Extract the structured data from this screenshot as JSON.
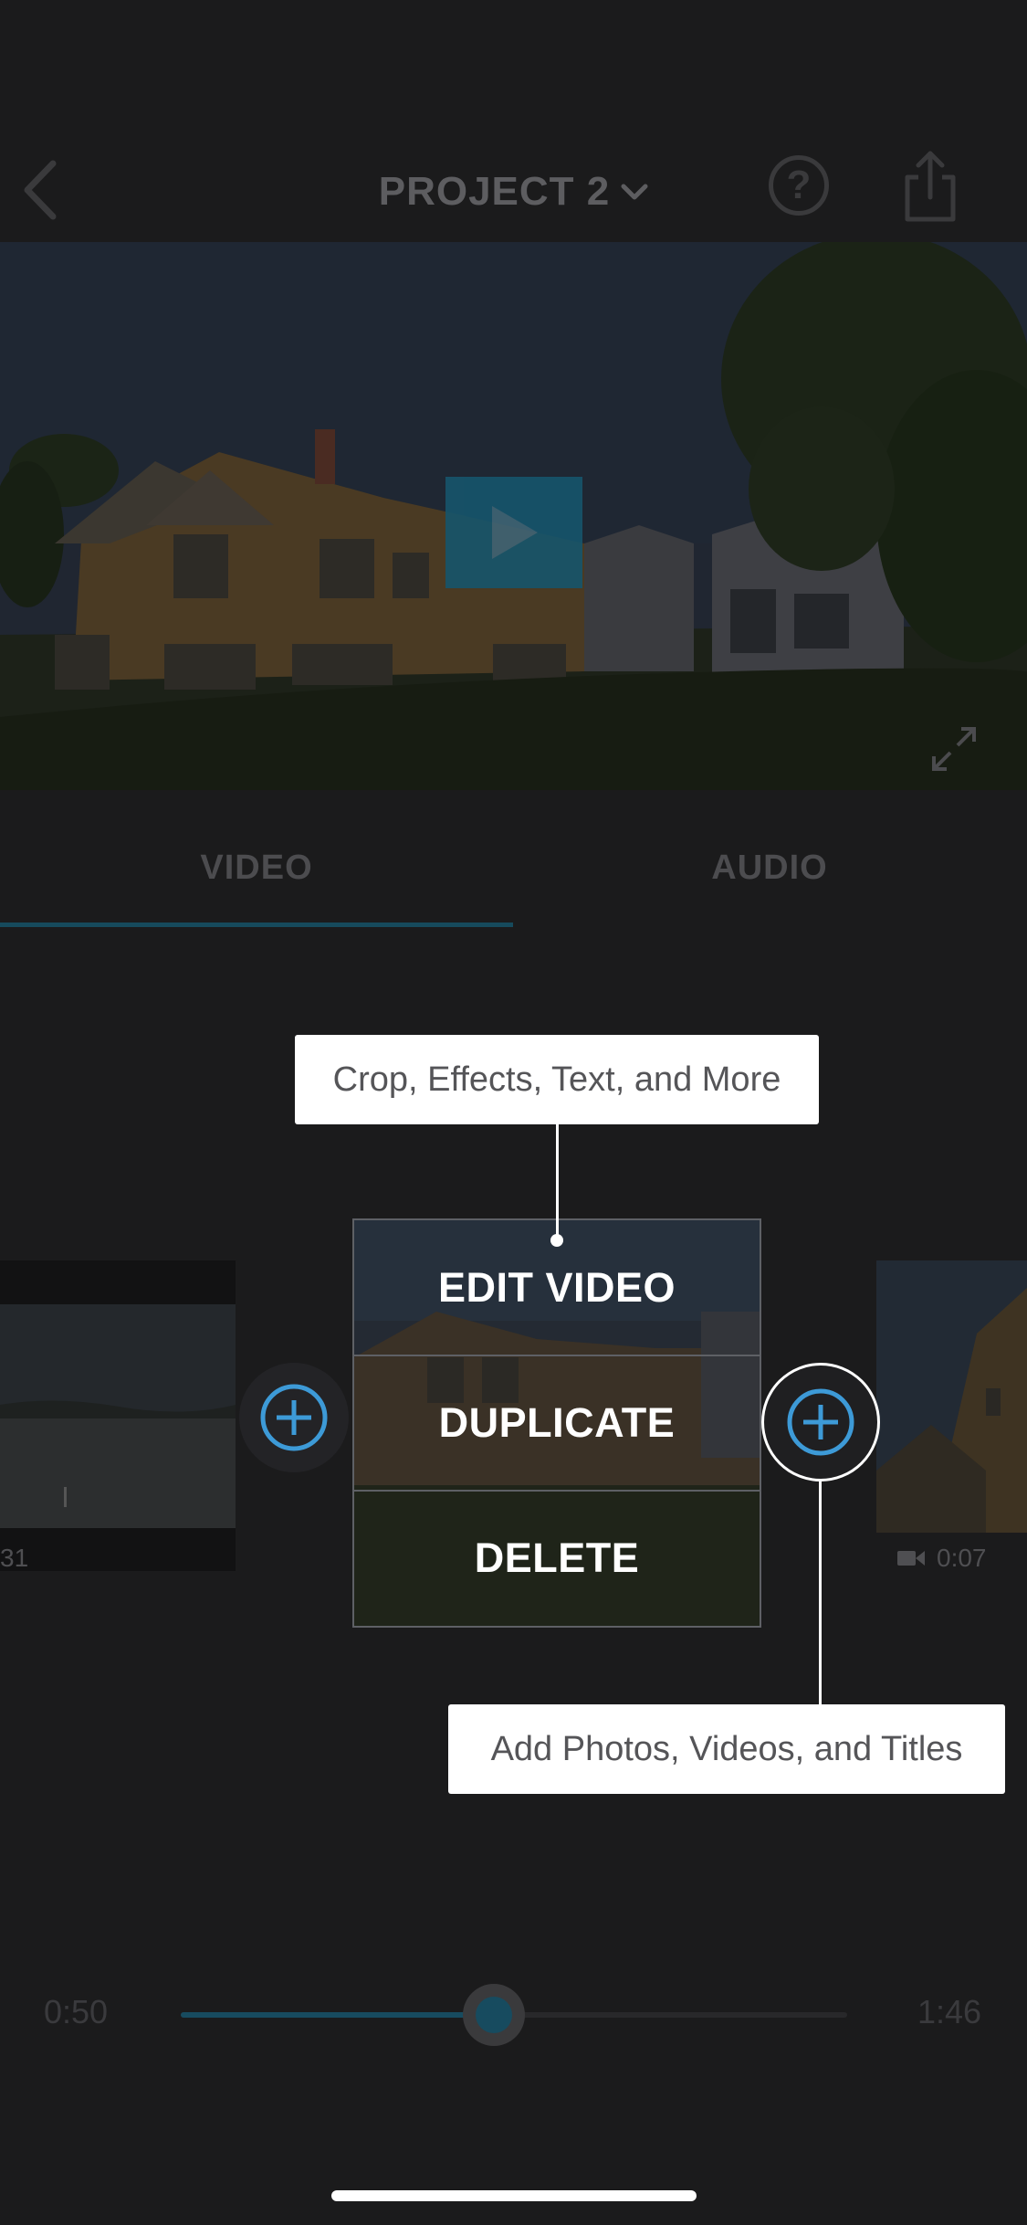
{
  "header": {
    "project_title": "PROJECT 2",
    "back_icon": "chevron-left-icon",
    "title_dropdown_icon": "chevron-down-icon",
    "help_label": "?",
    "share_icon": "share-icon"
  },
  "preview": {
    "play_icon": "play-icon",
    "fullscreen_icon": "expand-icon"
  },
  "tabs": [
    {
      "label": "VIDEO",
      "active": true
    },
    {
      "label": "AUDIO",
      "active": false
    }
  ],
  "timeline": {
    "left_clip_duration": "31",
    "right_clip_duration": "0:07",
    "right_clip_icon": "video-camera-icon",
    "add_icon": "plus-circle-icon"
  },
  "menu": {
    "edit_label": "EDIT VIDEO",
    "duplicate_label": "DUPLICATE",
    "delete_label": "DELETE"
  },
  "tooltips": {
    "edit_hint": "Crop, Effects, Text, and More",
    "add_hint": "Add Photos, Videos, and Titles"
  },
  "scrubber": {
    "current_time": "0:50",
    "total_time": "1:46",
    "progress": 0.47
  },
  "colors": {
    "background": "#1b1b1c",
    "accent": "#3d9ad7",
    "dim_accent": "#174b5f"
  }
}
